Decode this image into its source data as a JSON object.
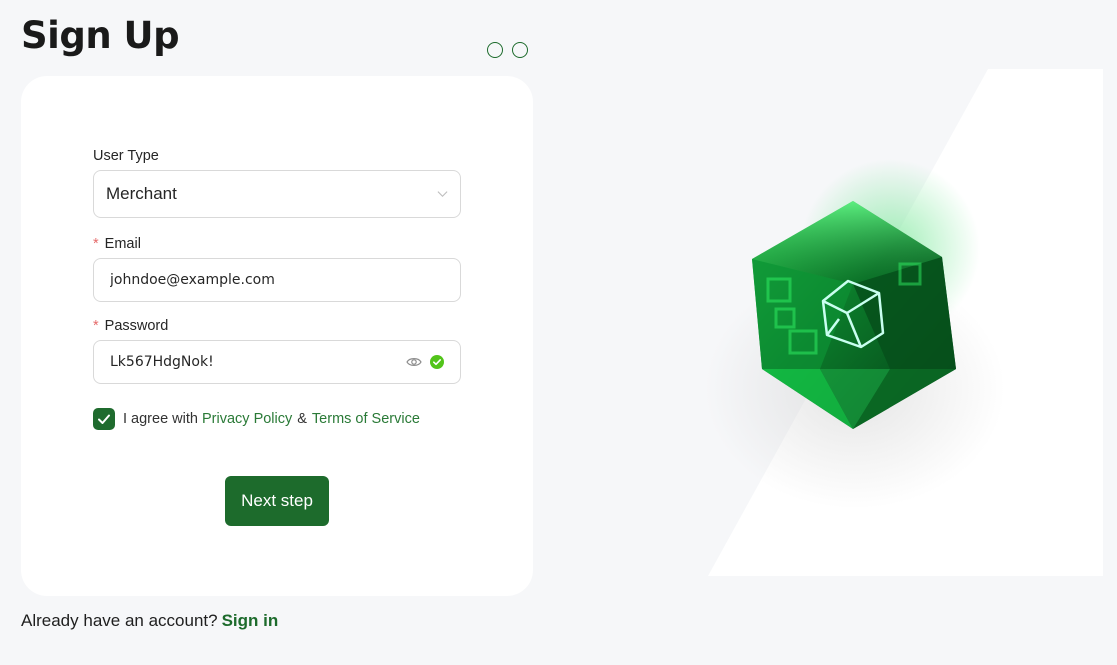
{
  "page": {
    "title": "Sign Up",
    "steps_total": 2
  },
  "form": {
    "user_type": {
      "label": "User Type",
      "value": "Merchant"
    },
    "email": {
      "label": "Email",
      "required_mark": "*",
      "value": "johndoe@example.com"
    },
    "password": {
      "label": "Password",
      "required_mark": "*",
      "value": "Lk567HdgNok!",
      "visibility_icon": "eye-icon",
      "valid_icon": "check-circle-icon"
    },
    "agreement": {
      "checked": true,
      "prefix": "I agree with",
      "privacy_link": "Privacy Policy",
      "separator": "&",
      "terms_link": "Terms of Service"
    },
    "next_button": "Next step"
  },
  "footer": {
    "prompt": "Already have an account?",
    "signin_link": "Sign in"
  },
  "colors": {
    "brand_green": "#1d6b2c",
    "link_green": "#2a7a37",
    "page_bg": "#f6f7f9",
    "required_red": "#e56a6a"
  }
}
